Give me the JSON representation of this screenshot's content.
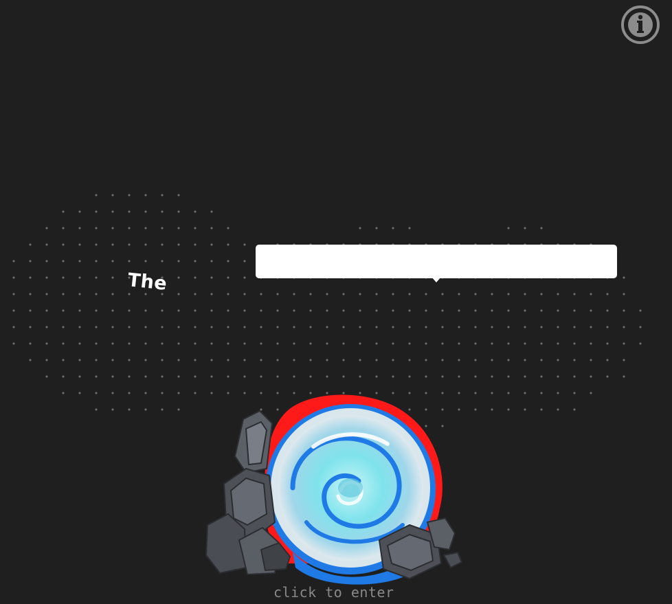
{
  "header": {
    "info_button_icon": "info-circle-icon"
  },
  "hero": {
    "title_word": "The",
    "speech_bubble_text": ""
  },
  "portal": {
    "icon": "swirl-portal-icon",
    "enter_label": "click to enter"
  },
  "colors": {
    "background": "#1f1f1f",
    "dots": "#6a6a6a",
    "info_icon": "#8c8c8c",
    "portal_water_light": "#7fe3ec",
    "portal_water_deep": "#1f7ae6",
    "portal_rim": "#ff1a1a",
    "rocks": "#4d5157"
  }
}
